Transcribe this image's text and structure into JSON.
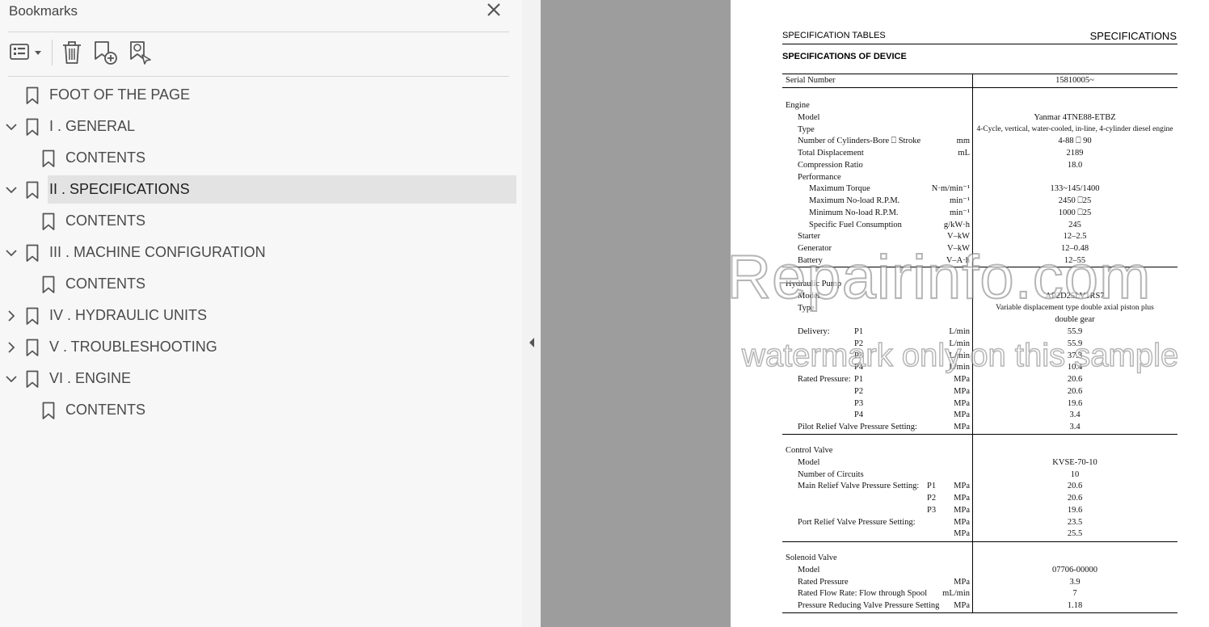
{
  "sidebar": {
    "title": "Bookmarks",
    "bookmarks": [
      {
        "label": "FOOT OF THE PAGE",
        "indent": 0,
        "expander": "none",
        "selected": false
      },
      {
        "label": "I . GENERAL",
        "indent": 0,
        "expander": "expanded",
        "selected": false
      },
      {
        "label": "CONTENTS",
        "indent": 1,
        "expander": "none",
        "selected": false
      },
      {
        "label": "II . SPECIFICATIONS",
        "indent": 0,
        "expander": "expanded",
        "selected": true
      },
      {
        "label": "CONTENTS",
        "indent": 1,
        "expander": "none",
        "selected": false
      },
      {
        "label": "III . MACHINE CONFIGURATION",
        "indent": 0,
        "expander": "expanded",
        "selected": false
      },
      {
        "label": "CONTENTS",
        "indent": 1,
        "expander": "none",
        "selected": false
      },
      {
        "label": "IV . HYDRAULIC UNITS",
        "indent": 0,
        "expander": "collapsed",
        "selected": false
      },
      {
        "label": "V . TROUBLESHOOTING",
        "indent": 0,
        "expander": "collapsed",
        "selected": false
      },
      {
        "label": "VI . ENGINE",
        "indent": 0,
        "expander": "expanded",
        "selected": false
      },
      {
        "label": "CONTENTS",
        "indent": 1,
        "expander": "none",
        "selected": false
      }
    ],
    "toolbar_icons": [
      "options-menu-icon",
      "delete-bookmark-icon",
      "new-bookmark-icon",
      "bookmark-search-icon"
    ]
  },
  "document": {
    "header_left": "SPECIFICATION TABLES",
    "header_right": "SPECIFICATIONS",
    "subtitle": "SPECIFICATIONS OF DEVICE",
    "watermark_line1": "eRepairinfo.com",
    "watermark_line2": "watermark only on this sample",
    "rows": [
      {
        "label": "Serial Number",
        "unit": "",
        "value": "15810005~",
        "indent": 0
      },
      {
        "label": "Engine",
        "unit": "",
        "value": "",
        "indent": 0
      },
      {
        "label": "Model",
        "unit": "",
        "value": "Yanmar 4TNE88-ETBZ",
        "indent": 1
      },
      {
        "label": "Type",
        "unit": "",
        "value": "4-Cycle, vertical, water-cooled, in-line, 4-cylinder diesel engine",
        "indent": 1
      },
      {
        "label": "Number of Cylinders-Bore ⎕ Stroke",
        "unit": "mm",
        "value": "4-88 ⎕ 90",
        "indent": 1
      },
      {
        "label": "Total Displacement",
        "unit": "mL",
        "value": "2189",
        "indent": 1
      },
      {
        "label": "Compression Ratio",
        "unit": "",
        "value": "18.0",
        "indent": 1
      },
      {
        "label": "Performance",
        "unit": "",
        "value": "",
        "indent": 1
      },
      {
        "label": "Maximum Torque",
        "unit": "N·m/min⁻¹",
        "value": "133~145/1400",
        "indent": 2
      },
      {
        "label": "Maximum No-load R.P.M.",
        "unit": "min⁻¹",
        "value": "2450 ⎕25",
        "indent": 2
      },
      {
        "label": "Minimum No-load R.P.M.",
        "unit": "min⁻¹",
        "value": "1000 ⎕25",
        "indent": 2
      },
      {
        "label": "Specific Fuel Consumption",
        "unit": "g/kW·h",
        "value": "245",
        "indent": 2
      },
      {
        "label": "Starter",
        "unit": "V–kW",
        "value": "12–2.5",
        "indent": 1
      },
      {
        "label": "Generator",
        "unit": "V–kW",
        "value": "12–0.48",
        "indent": 1
      },
      {
        "label": "Battery",
        "unit": "V–A·h",
        "value": "12–55",
        "indent": 1
      },
      {
        "label": "Hydraulic Pump",
        "unit": "",
        "value": "",
        "indent": 0
      },
      {
        "label": "Model",
        "unit": "",
        "value": "AP2D25LV1RS7",
        "indent": 1
      },
      {
        "label": "Type",
        "unit": "",
        "value": "Variable displacement type double axial piston plus",
        "indent": 1
      },
      {
        "label": "",
        "unit": "",
        "value": "double gear",
        "indent": 1
      },
      {
        "label": "Delivery:",
        "sub": "P1",
        "unit": "L/min",
        "value": "55.9",
        "indent": 1
      },
      {
        "label": "",
        "sub": "P2",
        "unit": "L/min",
        "value": "55.9",
        "indent": 1
      },
      {
        "label": "",
        "sub": "P3",
        "unit": "L/min",
        "value": "37.3",
        "indent": 1
      },
      {
        "label": "",
        "sub": "P4",
        "unit": "L/min",
        "value": "10.4",
        "indent": 1
      },
      {
        "label": "Rated Pressure:",
        "sub": "P1",
        "unit": "MPa",
        "value": "20.6",
        "indent": 1
      },
      {
        "label": "",
        "sub": "P2",
        "unit": "MPa",
        "value": "20.6",
        "indent": 1
      },
      {
        "label": "",
        "sub": "P3",
        "unit": "MPa",
        "value": "19.6",
        "indent": 1
      },
      {
        "label": "",
        "sub": "P4",
        "unit": "MPa",
        "value": "3.4",
        "indent": 1
      },
      {
        "label": "Pilot Relief Valve Pressure Setting:",
        "unit": "MPa",
        "value": "3.4",
        "indent": 1
      },
      {
        "label": "Control Valve",
        "unit": "",
        "value": "",
        "indent": 0
      },
      {
        "label": "Model",
        "unit": "",
        "value": "KVSE-70-10",
        "indent": 1
      },
      {
        "label": "Number of Circuits",
        "unit": "",
        "value": "10",
        "indent": 1
      },
      {
        "label": "Main Relief Valve Pressure Setting:",
        "sub2": "P1",
        "unit": "MPa",
        "value": "20.6",
        "indent": 1
      },
      {
        "label": "",
        "sub2": "P2",
        "unit": "MPa",
        "value": "20.6",
        "indent": 1
      },
      {
        "label": "",
        "sub2": "P3",
        "unit": "MPa",
        "value": "19.6",
        "indent": 1
      },
      {
        "label": "Port Relief Valve Pressure Setting:",
        "unit": "MPa",
        "value": "23.5",
        "indent": 1
      },
      {
        "label": "",
        "unit": "MPa",
        "value": "25.5",
        "indent": 1
      },
      {
        "label": "Solenoid Valve",
        "unit": "",
        "value": "",
        "indent": 0
      },
      {
        "label": "Model",
        "unit": "",
        "value": "07706-00000",
        "indent": 1
      },
      {
        "label": "Rated Pressure",
        "unit": "MPa",
        "value": "3.9",
        "indent": 1
      },
      {
        "label": "Rated Flow Rate: Flow through Spool",
        "unit": "mL/min",
        "value": "7",
        "indent": 1
      },
      {
        "label": "Pressure Reducing Valve Pressure Setting",
        "unit": "MPa",
        "value": "1.18",
        "indent": 1
      }
    ]
  }
}
